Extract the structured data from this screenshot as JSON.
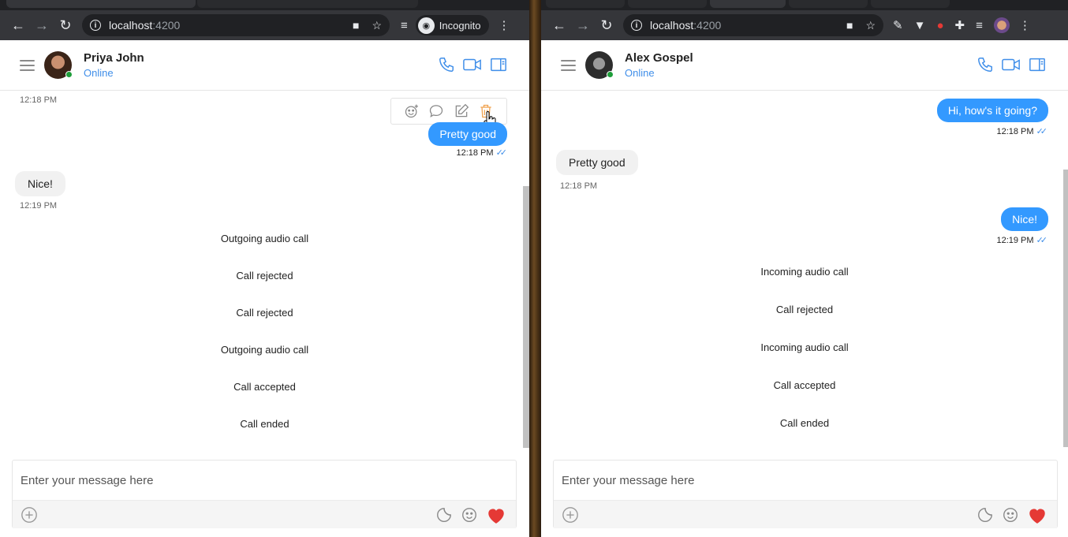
{
  "left": {
    "address": {
      "host": "localhost",
      "port": ":4200"
    },
    "incognito_label": "Incognito",
    "contact": {
      "name": "Priya John",
      "status": "Online"
    },
    "messages": {
      "ts_top": "12:18 PM",
      "out1": "Pretty good",
      "out1_ts": "12:18 PM",
      "in1": "Nice!",
      "in1_ts": "12:19 PM"
    },
    "calls": [
      "Outgoing audio call",
      "Call rejected",
      "Call rejected",
      "Outgoing audio call",
      "Call accepted",
      "Call ended"
    ],
    "composer_placeholder": "Enter your message here"
  },
  "right": {
    "address": {
      "host": "localhost",
      "port": ":4200"
    },
    "contact": {
      "name": "Alex Gospel",
      "status": "Online"
    },
    "messages": {
      "out1": "Hi, how's it going?",
      "out1_ts": "12:18 PM",
      "in1": "Pretty good",
      "in1_ts": "12:18 PM",
      "out2": "Nice!",
      "out2_ts": "12:19 PM"
    },
    "calls": [
      "Incoming audio call",
      "Call rejected",
      "Incoming audio call",
      "Call accepted",
      "Call ended"
    ],
    "composer_placeholder": "Enter your message here"
  },
  "colors": {
    "accent": "#3399ff",
    "online": "#1e9e3a",
    "heart": "#e53935",
    "delete_hover": "#f0a04b"
  },
  "icons": [
    "back-icon",
    "forward-icon",
    "reload-icon",
    "info-icon",
    "camera-icon",
    "star-icon",
    "queue-icon",
    "incognito-icon",
    "menu-icon",
    "hamburger-icon",
    "phone-icon",
    "video-icon",
    "sidebar-icon",
    "react-icon",
    "reply-icon",
    "edit-icon",
    "trash-icon",
    "plus-icon",
    "sticker-icon",
    "emoji-icon",
    "heart-icon",
    "extensions-icon"
  ]
}
